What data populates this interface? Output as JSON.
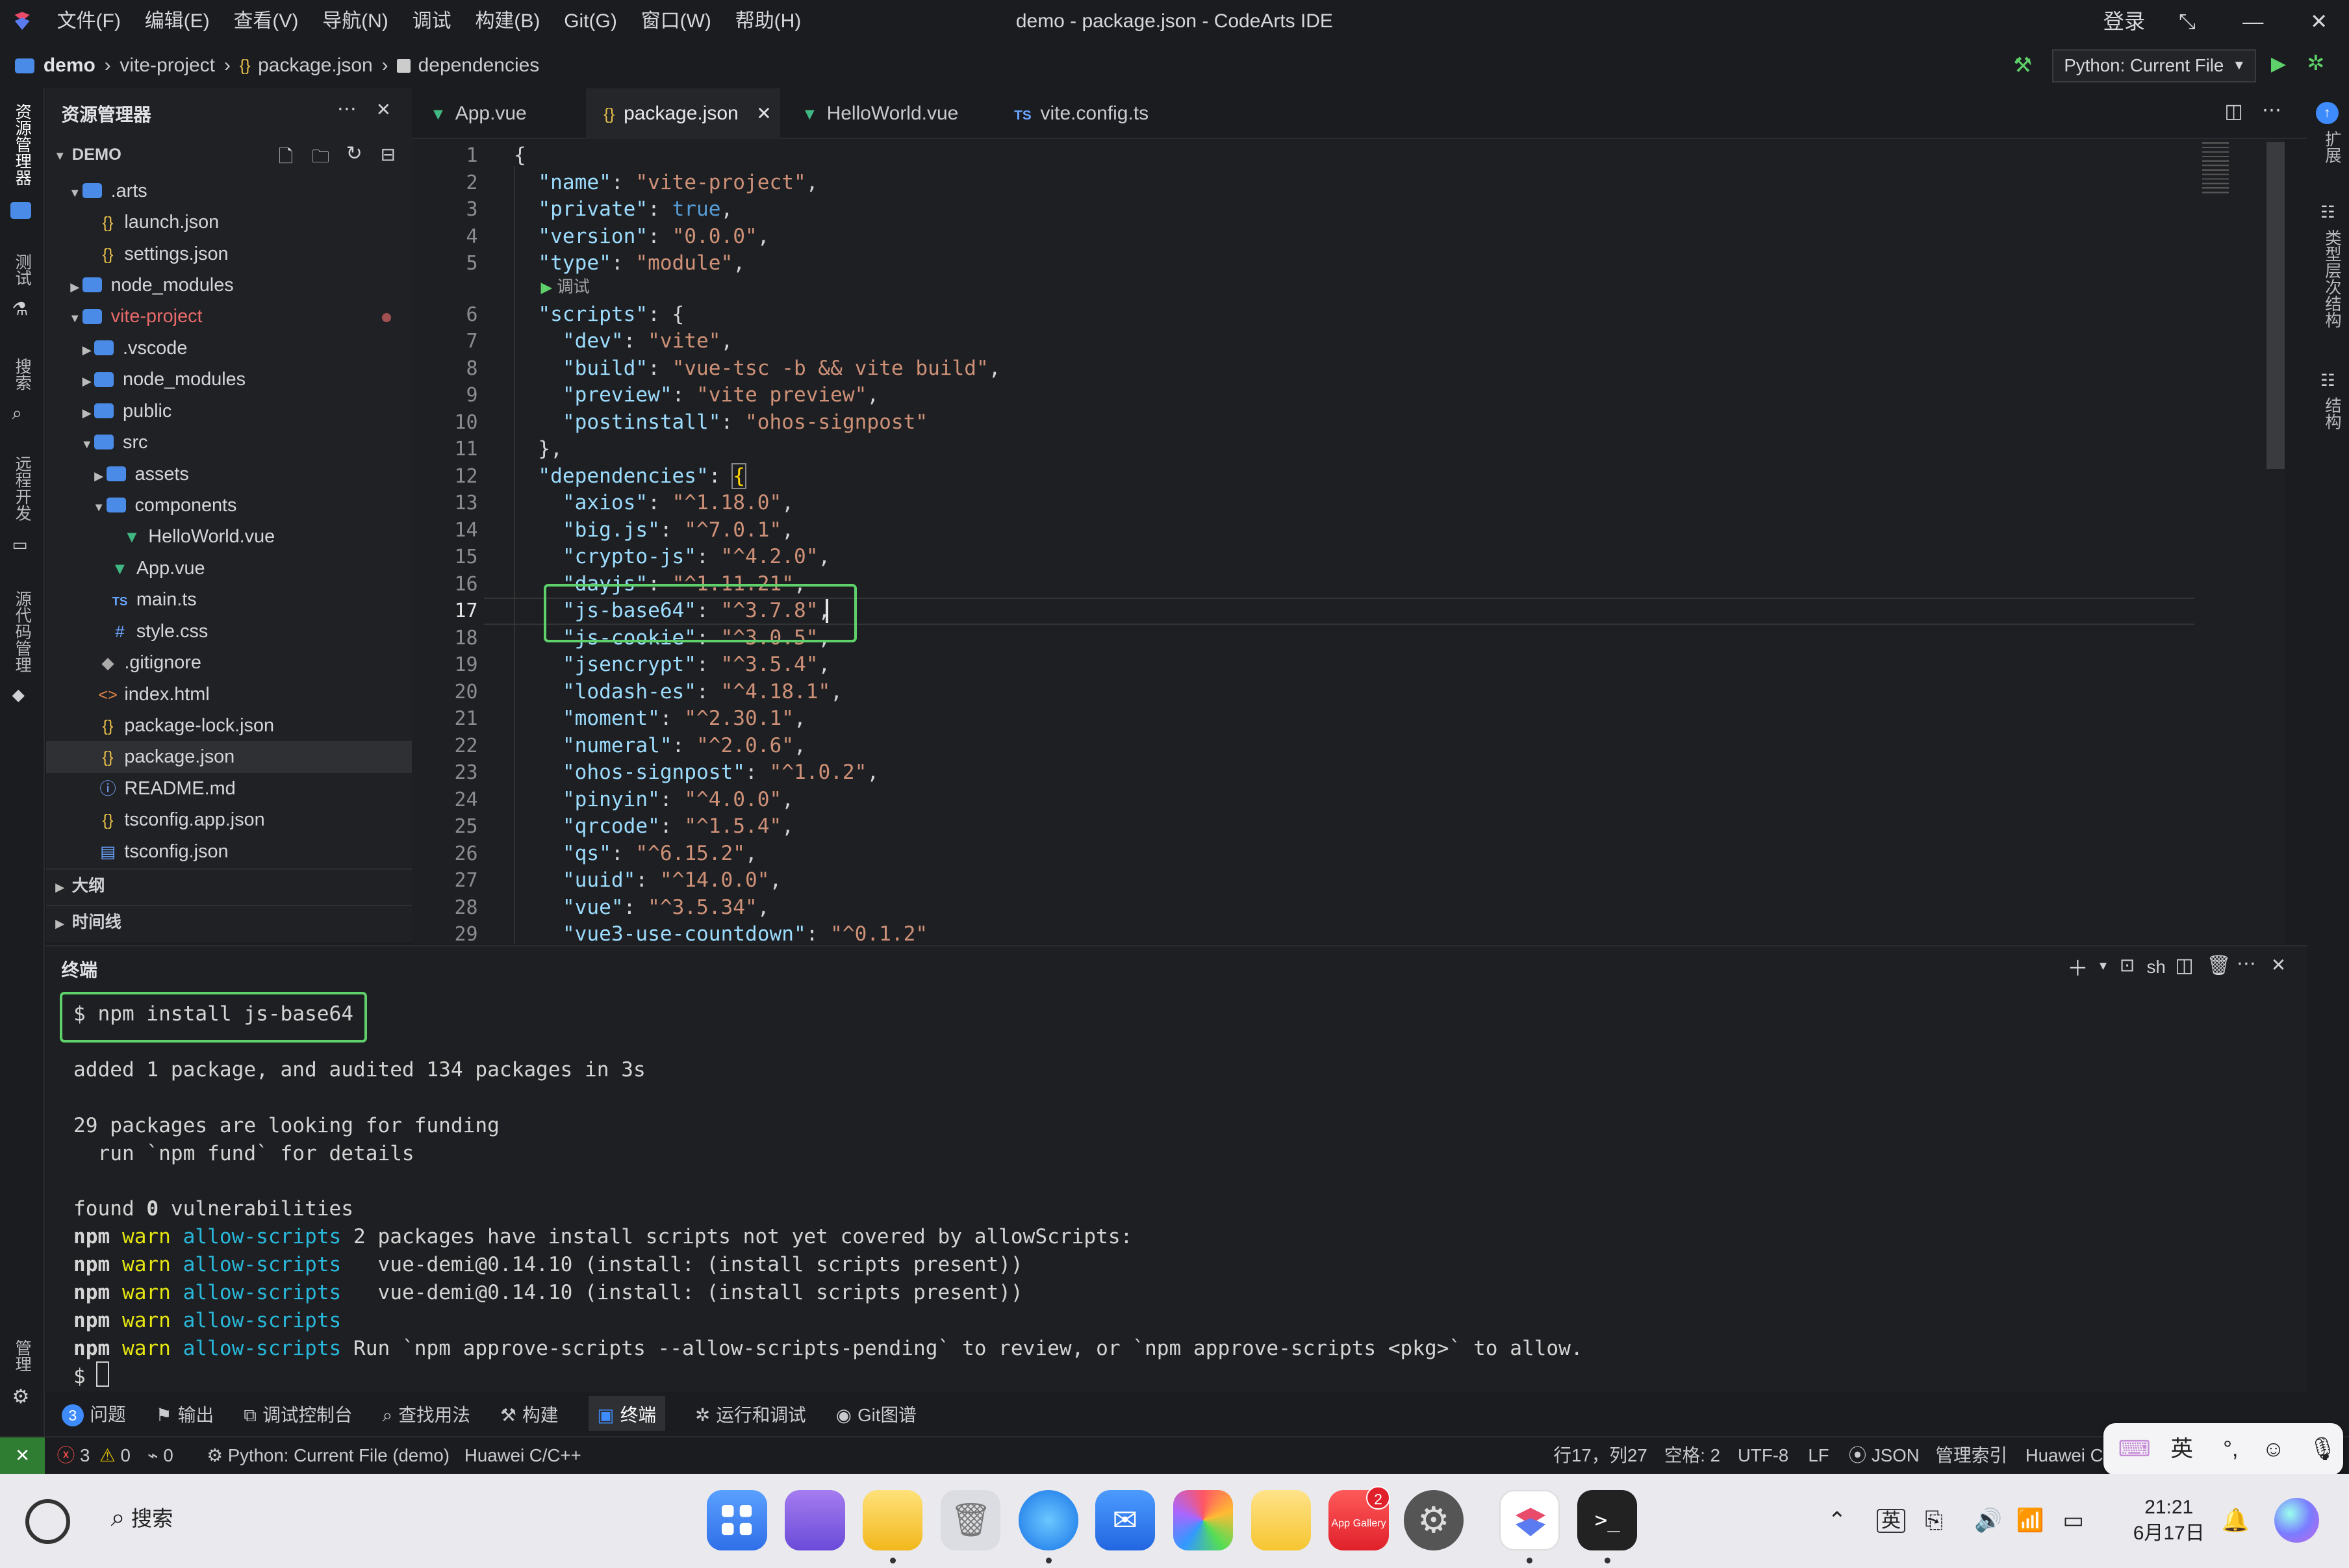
{
  "titlebar": {
    "menus": [
      "文件(F)",
      "编辑(E)",
      "查看(V)",
      "导航(N)",
      "调试",
      "构建(B)",
      "Git(G)",
      "窗口(W)",
      "帮助(H)"
    ],
    "title": "demo - package.json - CodeArts IDE",
    "login": "登录",
    "minimize": "—",
    "maximize": "☐",
    "close": "✕"
  },
  "breadcrumb": {
    "items": [
      "demo",
      "vite-project",
      "package.json",
      "dependencies"
    ],
    "run_config": "Python: Current File"
  },
  "activity": {
    "items": [
      "资源管理器",
      "测试",
      "搜索",
      "远程开发",
      "源代码管理",
      "管理"
    ]
  },
  "rightbar": {
    "items": [
      "扩展",
      "类型层次结构",
      "结构"
    ]
  },
  "sidebar": {
    "title": "资源管理器",
    "root": "DEMO",
    "tree": [
      {
        "label": ".arts",
        "kind": "folder",
        "level": 1,
        "open": true
      },
      {
        "label": "launch.json",
        "kind": "json",
        "level": 2
      },
      {
        "label": "settings.json",
        "kind": "json",
        "level": 2
      },
      {
        "label": "node_modules",
        "kind": "folder",
        "level": 1,
        "open": false
      },
      {
        "label": "vite-project",
        "kind": "folder",
        "level": 1,
        "open": true,
        "modified": true
      },
      {
        "label": ".vscode",
        "kind": "folder",
        "level": 2,
        "open": false
      },
      {
        "label": "node_modules",
        "kind": "folder",
        "level": 2,
        "open": false
      },
      {
        "label": "public",
        "kind": "folder",
        "level": 2,
        "open": false
      },
      {
        "label": "src",
        "kind": "folder",
        "level": 2,
        "open": true
      },
      {
        "label": "assets",
        "kind": "folder",
        "level": 3,
        "open": false
      },
      {
        "label": "components",
        "kind": "folder",
        "level": 3,
        "open": true
      },
      {
        "label": "HelloWorld.vue",
        "kind": "vue",
        "level": 4
      },
      {
        "label": "App.vue",
        "kind": "vue",
        "level": 3
      },
      {
        "label": "main.ts",
        "kind": "ts",
        "level": 3
      },
      {
        "label": "style.css",
        "kind": "css",
        "level": 3
      },
      {
        "label": ".gitignore",
        "kind": "git",
        "level": 2
      },
      {
        "label": "index.html",
        "kind": "html",
        "level": 2
      },
      {
        "label": "package-lock.json",
        "kind": "json",
        "level": 2
      },
      {
        "label": "package.json",
        "kind": "json",
        "level": 2,
        "selected": true
      },
      {
        "label": "README.md",
        "kind": "info",
        "level": 2
      },
      {
        "label": "tsconfig.app.json",
        "kind": "json",
        "level": 2
      },
      {
        "label": "tsconfig.json",
        "kind": "tsjson",
        "level": 2
      }
    ],
    "outline": "大纲",
    "timeline": "时间线"
  },
  "tabs": [
    {
      "label": "App.vue",
      "icon": "vue"
    },
    {
      "label": "package.json",
      "icon": "json",
      "active": true
    },
    {
      "label": "HelloWorld.vue",
      "icon": "vue"
    },
    {
      "label": "vite.config.ts",
      "icon": "ts"
    }
  ],
  "editor": {
    "codelens": "调试",
    "lines": [
      {
        "n": "1",
        "code": [
          [
            "p",
            "{"
          ]
        ]
      },
      {
        "n": "2",
        "code": [
          [
            "p",
            "  "
          ],
          [
            "k",
            "\"name\""
          ],
          [
            "p",
            ": "
          ],
          [
            "s",
            "\"vite-project\""
          ],
          [
            "p",
            ","
          ]
        ]
      },
      {
        "n": "3",
        "code": [
          [
            "p",
            "  "
          ],
          [
            "k",
            "\"private\""
          ],
          [
            "p",
            ": "
          ],
          [
            "b",
            "true"
          ],
          [
            "p",
            ","
          ]
        ]
      },
      {
        "n": "4",
        "code": [
          [
            "p",
            "  "
          ],
          [
            "k",
            "\"version\""
          ],
          [
            "p",
            ": "
          ],
          [
            "s",
            "\"0.0.0\""
          ],
          [
            "p",
            ","
          ]
        ]
      },
      {
        "n": "5",
        "code": [
          [
            "p",
            "  "
          ],
          [
            "k",
            "\"type\""
          ],
          [
            "p",
            ": "
          ],
          [
            "s",
            "\"module\""
          ],
          [
            "p",
            ","
          ]
        ]
      },
      {
        "n": "6",
        "code": [
          [
            "p",
            "  "
          ],
          [
            "k",
            "\"scripts\""
          ],
          [
            "p",
            ": {"
          ]
        ]
      },
      {
        "n": "7",
        "code": [
          [
            "p",
            "    "
          ],
          [
            "k",
            "\"dev\""
          ],
          [
            "p",
            ": "
          ],
          [
            "s",
            "\"vite\""
          ],
          [
            "p",
            ","
          ]
        ]
      },
      {
        "n": "8",
        "code": [
          [
            "p",
            "    "
          ],
          [
            "k",
            "\"build\""
          ],
          [
            "p",
            ": "
          ],
          [
            "s",
            "\"vue-tsc -b && vite build\""
          ],
          [
            "p",
            ","
          ]
        ]
      },
      {
        "n": "9",
        "code": [
          [
            "p",
            "    "
          ],
          [
            "k",
            "\"preview\""
          ],
          [
            "p",
            ": "
          ],
          [
            "s",
            "\"vite preview\""
          ],
          [
            "p",
            ","
          ]
        ]
      },
      {
        "n": "10",
        "code": [
          [
            "p",
            "    "
          ],
          [
            "k",
            "\"postinstall\""
          ],
          [
            "p",
            ": "
          ],
          [
            "s",
            "\"ohos-signpost\""
          ]
        ]
      },
      {
        "n": "11",
        "code": [
          [
            "p",
            "  },"
          ]
        ]
      },
      {
        "n": "12",
        "code": [
          [
            "p",
            "  "
          ],
          [
            "k",
            "\"dependencies\""
          ],
          [
            "p",
            ": "
          ],
          [
            "br",
            "{"
          ]
        ]
      },
      {
        "n": "13",
        "code": [
          [
            "p",
            "    "
          ],
          [
            "k",
            "\"axios\""
          ],
          [
            "p",
            ": "
          ],
          [
            "s",
            "\"^1.18.0\""
          ],
          [
            "p",
            ","
          ]
        ]
      },
      {
        "n": "14",
        "code": [
          [
            "p",
            "    "
          ],
          [
            "k",
            "\"big.js\""
          ],
          [
            "p",
            ": "
          ],
          [
            "s",
            "\"^7.0.1\""
          ],
          [
            "p",
            ","
          ]
        ]
      },
      {
        "n": "15",
        "code": [
          [
            "p",
            "    "
          ],
          [
            "k",
            "\"crypto-js\""
          ],
          [
            "p",
            ": "
          ],
          [
            "s",
            "\"^4.2.0\""
          ],
          [
            "p",
            ","
          ]
        ]
      },
      {
        "n": "16",
        "code": [
          [
            "p",
            "    "
          ],
          [
            "k",
            "\"dayjs\""
          ],
          [
            "p",
            ": "
          ],
          [
            "s",
            "\"^1.11.21\""
          ],
          [
            "p",
            ","
          ]
        ]
      },
      {
        "n": "17",
        "code": [
          [
            "p",
            "    "
          ],
          [
            "k",
            "\"js-base64\""
          ],
          [
            "p",
            ": "
          ],
          [
            "s",
            "\"^3.7.8\""
          ],
          [
            "p",
            ","
          ]
        ]
      },
      {
        "n": "18",
        "code": [
          [
            "p",
            "    "
          ],
          [
            "k",
            "\"js-cookie\""
          ],
          [
            "p",
            ": "
          ],
          [
            "s",
            "\"^3.0.5\""
          ],
          [
            "p",
            ","
          ]
        ]
      },
      {
        "n": "19",
        "code": [
          [
            "p",
            "    "
          ],
          [
            "k",
            "\"jsencrypt\""
          ],
          [
            "p",
            ": "
          ],
          [
            "s",
            "\"^3.5.4\""
          ],
          [
            "p",
            ","
          ]
        ]
      },
      {
        "n": "20",
        "code": [
          [
            "p",
            "    "
          ],
          [
            "k",
            "\"lodash-es\""
          ],
          [
            "p",
            ": "
          ],
          [
            "s",
            "\"^4.18.1\""
          ],
          [
            "p",
            ","
          ]
        ]
      },
      {
        "n": "21",
        "code": [
          [
            "p",
            "    "
          ],
          [
            "k",
            "\"moment\""
          ],
          [
            "p",
            ": "
          ],
          [
            "s",
            "\"^2.30.1\""
          ],
          [
            "p",
            ","
          ]
        ]
      },
      {
        "n": "22",
        "code": [
          [
            "p",
            "    "
          ],
          [
            "k",
            "\"numeral\""
          ],
          [
            "p",
            ": "
          ],
          [
            "s",
            "\"^2.0.6\""
          ],
          [
            "p",
            ","
          ]
        ]
      },
      {
        "n": "23",
        "code": [
          [
            "p",
            "    "
          ],
          [
            "k",
            "\"ohos-signpost\""
          ],
          [
            "p",
            ": "
          ],
          [
            "s",
            "\"^1.0.2\""
          ],
          [
            "p",
            ","
          ]
        ]
      },
      {
        "n": "24",
        "code": [
          [
            "p",
            "    "
          ],
          [
            "k",
            "\"pinyin\""
          ],
          [
            "p",
            ": "
          ],
          [
            "s",
            "\"^4.0.0\""
          ],
          [
            "p",
            ","
          ]
        ]
      },
      {
        "n": "25",
        "code": [
          [
            "p",
            "    "
          ],
          [
            "k",
            "\"qrcode\""
          ],
          [
            "p",
            ": "
          ],
          [
            "s",
            "\"^1.5.4\""
          ],
          [
            "p",
            ","
          ]
        ]
      },
      {
        "n": "26",
        "code": [
          [
            "p",
            "    "
          ],
          [
            "k",
            "\"qs\""
          ],
          [
            "p",
            ": "
          ],
          [
            "s",
            "\"^6.15.2\""
          ],
          [
            "p",
            ","
          ]
        ]
      },
      {
        "n": "27",
        "code": [
          [
            "p",
            "    "
          ],
          [
            "k",
            "\"uuid\""
          ],
          [
            "p",
            ": "
          ],
          [
            "s",
            "\"^14.0.0\""
          ],
          [
            "p",
            ","
          ]
        ]
      },
      {
        "n": "28",
        "code": [
          [
            "p",
            "    "
          ],
          [
            "k",
            "\"vue\""
          ],
          [
            "p",
            ": "
          ],
          [
            "s",
            "\"^3.5.34\""
          ],
          [
            "p",
            ","
          ]
        ]
      },
      {
        "n": "29",
        "code": [
          [
            "p",
            "    "
          ],
          [
            "k",
            "\"vue3-use-countdown\""
          ],
          [
            "p",
            ": "
          ],
          [
            "s",
            "\"^0.1.2\""
          ]
        ]
      }
    ]
  },
  "panel": {
    "title": "终端",
    "shell": "sh",
    "lines": [
      [
        [
          "p",
          "$ npm install js-base64"
        ]
      ],
      [
        [
          "p",
          ""
        ]
      ],
      [
        [
          "p",
          "added 1 package, and audited 134 packages in 3s"
        ]
      ],
      [
        [
          "p",
          ""
        ]
      ],
      [
        [
          "p",
          "29 packages are looking for funding"
        ]
      ],
      [
        [
          "p",
          "  run `npm fund` for details"
        ]
      ],
      [
        [
          "p",
          ""
        ]
      ],
      [
        [
          "p",
          "found "
        ],
        [
          "bold",
          "0"
        ],
        [
          "p",
          " vulnerabilities"
        ]
      ],
      [
        [
          "bold",
          "npm"
        ],
        [
          "p",
          " "
        ],
        [
          "warn",
          "warn"
        ],
        [
          "p",
          " "
        ],
        [
          "cyan",
          "allow-scripts"
        ],
        [
          "p",
          " 2 packages have install scripts not yet covered by allowScripts:"
        ]
      ],
      [
        [
          "bold",
          "npm"
        ],
        [
          "p",
          " "
        ],
        [
          "warn",
          "warn"
        ],
        [
          "p",
          " "
        ],
        [
          "cyan",
          "allow-scripts"
        ],
        [
          "p",
          "   vue-demi@0.14.10 (install: (install scripts present))"
        ]
      ],
      [
        [
          "bold",
          "npm"
        ],
        [
          "p",
          " "
        ],
        [
          "warn",
          "warn"
        ],
        [
          "p",
          " "
        ],
        [
          "cyan",
          "allow-scripts"
        ],
        [
          "p",
          "   vue-demi@0.14.10 (install: (install scripts present))"
        ]
      ],
      [
        [
          "bold",
          "npm"
        ],
        [
          "p",
          " "
        ],
        [
          "warn",
          "warn"
        ],
        [
          "p",
          " "
        ],
        [
          "cyan",
          "allow-scripts"
        ]
      ],
      [
        [
          "bold",
          "npm"
        ],
        [
          "p",
          " "
        ],
        [
          "warn",
          "warn"
        ],
        [
          "p",
          " "
        ],
        [
          "cyan",
          "allow-scripts"
        ],
        [
          "p",
          " Run `npm approve-scripts --allow-scripts-pending` to review, or `npm approve-scripts <pkg>` to allow."
        ]
      ],
      [
        [
          "p",
          "$ "
        ]
      ]
    ]
  },
  "panel_tabs": [
    {
      "label": "问题",
      "badge": "3"
    },
    {
      "label": "输出"
    },
    {
      "label": "调试控制台"
    },
    {
      "label": "查找用法"
    },
    {
      "label": "构建"
    },
    {
      "label": "终端",
      "active": true
    },
    {
      "label": "运行和调试"
    },
    {
      "label": "Git图谱"
    }
  ],
  "status": {
    "errors": "3",
    "warnings": "0",
    "ports": "0",
    "run": "Python: Current File (demo)",
    "lang_pack": "Huawei C/C++",
    "position": "行17，列27",
    "indent": "空格: 2",
    "encoding": "UTF-8",
    "eol": "LF",
    "language": "JSON",
    "index": "管理索引",
    "huawei": "Huawei C"
  },
  "ime": {
    "lang": "英"
  },
  "taskbar": {
    "search": "搜索",
    "time": "21:21",
    "date": "6月17日",
    "appgallery_badge": "2",
    "appgallery_label": "App Gallery",
    "ime_tray": "英"
  },
  "colors": {
    "accent": "#3d8bfd",
    "highlight_box": "#5ed16a",
    "string": "#ce9178",
    "key": "#9cdcfe"
  }
}
